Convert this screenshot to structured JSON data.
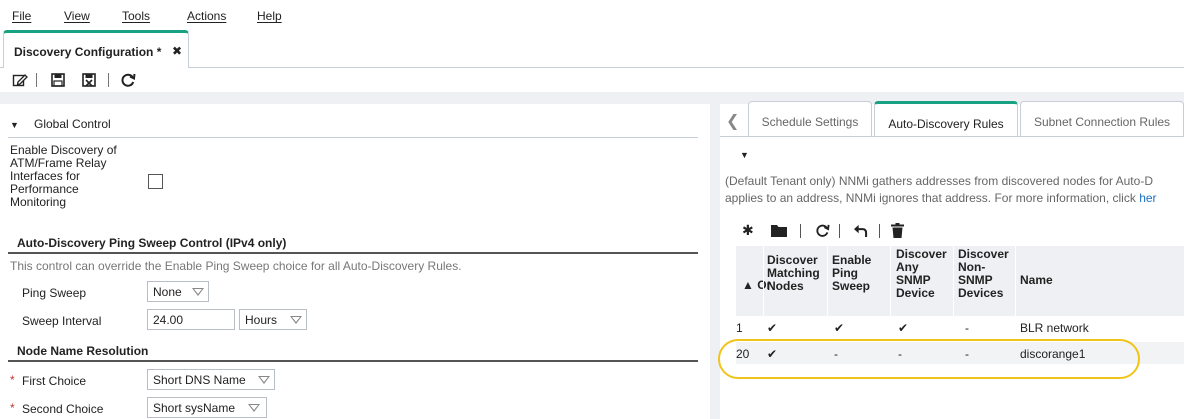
{
  "menu": {
    "file": "File",
    "view": "View",
    "tools": "Tools",
    "actions": "Actions",
    "help": "Help"
  },
  "doc_tab": {
    "label": "Discovery Configuration *",
    "close": "✖"
  },
  "toolbar": {
    "icons": [
      "edit-icon",
      "save-icon",
      "save-close-icon",
      "refresh-icon"
    ]
  },
  "left": {
    "global_control": "Global Control",
    "atm_label": "Enable Discovery of ATM/Frame Relay Interfaces for Performance Monitoring",
    "atm_lines": [
      "Enable Discovery of",
      "ATM/Frame Relay",
      "Interfaces for",
      "Performance",
      "Monitoring"
    ],
    "atm_checked": false,
    "ping_section": "Auto-Discovery Ping Sweep Control (IPv4 only)",
    "ping_note": "This control can override the Enable Ping Sweep choice for all Auto-Discovery Rules.",
    "ping_sweep_label": "Ping Sweep",
    "ping_sweep_value": "None",
    "sweep_interval_label": "Sweep Interval",
    "sweep_interval_value": "24.00",
    "sweep_unit_value": "Hours",
    "name_section": "Node Name Resolution",
    "first_choice_label": "First Choice",
    "first_choice_value": "Short DNS Name",
    "second_choice_label": "Second Choice",
    "second_choice_value": "Short sysName",
    "required_mark": "*"
  },
  "right": {
    "tabs": {
      "schedule": "Schedule Settings",
      "auto_discovery": "Auto-Discovery Rules",
      "subnet": "Subnet Connection Rules"
    },
    "desc_line1": "(Default Tenant only) NNMi gathers addresses from discovered nodes for Auto-D",
    "desc_line2": "applies to an address, NNMi ignores that address. For more information, click ",
    "desc_link": "her",
    "table": {
      "headers": {
        "order": "▲ Or",
        "matching": [
          "Discover",
          "Matching",
          "Nodes"
        ],
        "ping": [
          "Enable",
          "Ping",
          "Sweep"
        ],
        "snmp": [
          "Discover",
          "Any",
          "SNMP",
          "Device"
        ],
        "nonsnmp": [
          "Discover",
          "Non-",
          "SNMP",
          "Devices"
        ],
        "name": "Name"
      },
      "rows": [
        {
          "order": "1",
          "matching": "✔",
          "ping": "✔",
          "snmp": "✔",
          "nonsnmp": "-",
          "name": "BLR network"
        },
        {
          "order": "20",
          "matching": "✔",
          "ping": "-",
          "snmp": "-",
          "nonsnmp": "-",
          "name": "discorange1"
        }
      ]
    }
  },
  "colors": {
    "accent": "#18a182",
    "highlight": "#f0c419",
    "link": "#1a6fc0"
  }
}
